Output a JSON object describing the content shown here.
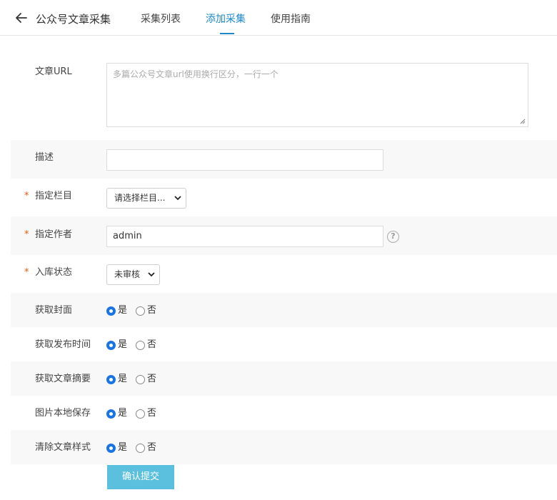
{
  "header": {
    "title": "公众号文章采集",
    "tabs": [
      {
        "label": "采集列表",
        "active": false
      },
      {
        "label": "添加采集",
        "active": true
      },
      {
        "label": "使用指南",
        "active": false
      }
    ],
    "accent_color": "#1e88c8"
  },
  "form": {
    "url": {
      "label": "文章URL",
      "placeholder": "多篇公众号文章url使用换行区分，一行一个",
      "value": ""
    },
    "description": {
      "label": "描述",
      "value": ""
    },
    "column": {
      "label": "指定栏目",
      "required": true,
      "selected": "请选择栏目..."
    },
    "author": {
      "label": "指定作者",
      "required": true,
      "value": "admin",
      "help": "?"
    },
    "status": {
      "label": "入库状态",
      "required": true,
      "selected": "未审核"
    },
    "radios": [
      {
        "label": "获取封面",
        "yes": "是",
        "no": "否",
        "value": "yes"
      },
      {
        "label": "获取发布时间",
        "yes": "是",
        "no": "否",
        "value": "yes"
      },
      {
        "label": "获取文章摘要",
        "yes": "是",
        "no": "否",
        "value": "yes"
      },
      {
        "label": "图片本地保存",
        "yes": "是",
        "no": "否",
        "value": "yes"
      },
      {
        "label": "清除文章样式",
        "yes": "是",
        "no": "否",
        "value": "yes"
      }
    ],
    "required_mark": "*",
    "submit_label": "确认提交",
    "submit_color": "#5bc0de"
  }
}
